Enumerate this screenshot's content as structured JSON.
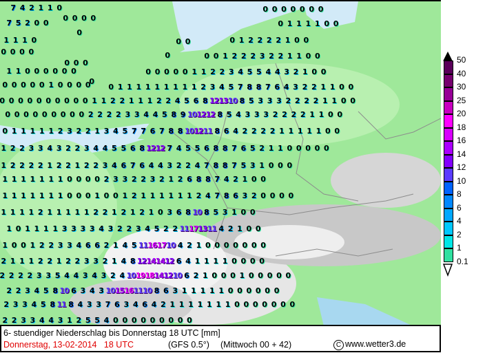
{
  "title": "6- stuendiger Niederschlag bis Donnerstag 18 UTC [mm]",
  "valid_time": "Donnerstag, 13-02-2014   18 UTC",
  "model": "(GFS 0.5°)",
  "run": "(Mittwoch 00 + 42)",
  "copyright_symbol": "C",
  "source": "www.wetter3.de",
  "legend": {
    "unit": "mm",
    "labels": [
      "50",
      "40",
      "30",
      "25",
      "20",
      "18",
      "16",
      "14",
      "12",
      "10",
      "8",
      "6",
      "4",
      "2",
      "1",
      "0.1"
    ],
    "colors": [
      "#5a005a",
      "#76006e",
      "#960096",
      "#c800c0",
      "#ff00ff",
      "#d800ff",
      "#aa00ff",
      "#8200ff",
      "#5a3cff",
      "#0064ff",
      "#0088ff",
      "#00a8ff",
      "#00c8ff",
      "#00e6e6",
      "#30e0a0"
    ]
  },
  "map_values": [
    "7 4 2 1 1 0",
    "0 0 0 0 0 0 0",
    "0 0 0 0",
    "7 5 2 0 0",
    "0 1 1 1 1 0 0",
    "0",
    "1 1 1 0",
    "0 1 2 2 2 2 1 0 0",
    "0 0",
    "0 0 0 0",
    "0",
    "0 0 1 2 2 2 3 2 2 1 1 0 0",
    "0 0 0",
    "1 1 0 0 0 0 0 0",
    "0 0 0 0 0 1 1 2 2 3 4 5 5 4 4 3 2 1 0 0",
    "0",
    "0 0 0 0 0 1 0 0 0 0",
    "0 1 1 1 1 1 1 1 1 1 2 3 4 5 7 8 8 7 6 4 3 2 2 1 1 0 0",
    "0 0 0 0 0 0 0 0 0 0 1 1 2 2 1 1 1 2 2 4 5 6 8 12 13 10 8 5 3 3 3 2 2 2 2 1 1 0 0",
    "0 0 0 0 0 0 0 0 0 2 2 2 2 3 3 4 4 5 8 9 10 12 12 8 5 4 3 3 3 2 2 2 2 1 1 0 0",
    "0 1 1 1 1 1 2 3 2 2 1 3 4 5 7 7 6 7 8 8 10 12 11 8 6 4 2 2 2 2 1 1 1 1 1 0 0",
    "1 2 2 3 3 4 3 2 2 3 4 4 5 5 6 8 12 12 7 4 5 5 6 8 8 7 6 5 2 1 1 0 0 0 0 0",
    "1 2 2 2 2 1 2 2 1 2 2 3 4 6 7 6 4 4 3 2 2 4 7 8 8 7 5 3 1 0 0 0",
    "1 1 1 1 1 1 1 0 0 0 0 2 3 3 2 2 3 2 1 2 6 8 8 7 4 2 1 0 0",
    "1 1 1 1 1 1 1 0 0 0 1 0 0 1 2 1 1 1 1 1 1 2 4 7 8 6 3 2 0 0 0 0",
    "1 1 1 1 2 1 1 1 1 1 2 2 1 2 1 2 1 0 3 6 8 10 8 5 3 1 0 0",
    "1 0 1 1 1 1 3 3 3 3 4 3 2 2 3 4 5 2 2 11 17 13 11 4 2 1 0 0",
    "1 0 0 1 2 2 3 3 4 6 6 2 1 4 5 11 16 17 10 4 2 1 0 0 0 0 0 0 0",
    "2 1 1 1 2 2 1 2 2 3 3 2 1 4 8 12 14 14 12 6 4 1 1 1 1 0 0 0 0",
    "2 2 2 2 3 3 5 4 4 3 4 3 2 4 10 19 18 14 12 10 6 2 1 0 0 0 1 0 0 0 0 0",
    "2 2 3 4 5 8 10 6 3 4 3 10 15 16 11 10 8 6 3 1 1 1 1 1 0 0 0 0 0 0",
    "2 3 3 4 5 8 11 8 4 3 3 7 6 3 4 6 4 2 1 1 1 1 1 1 1 0 0 0 0 0 0 0",
    "2 2 3 3 4 4 3 1 2 5 5 4 0 0 0 0 0 0 0 0 0"
  ]
}
